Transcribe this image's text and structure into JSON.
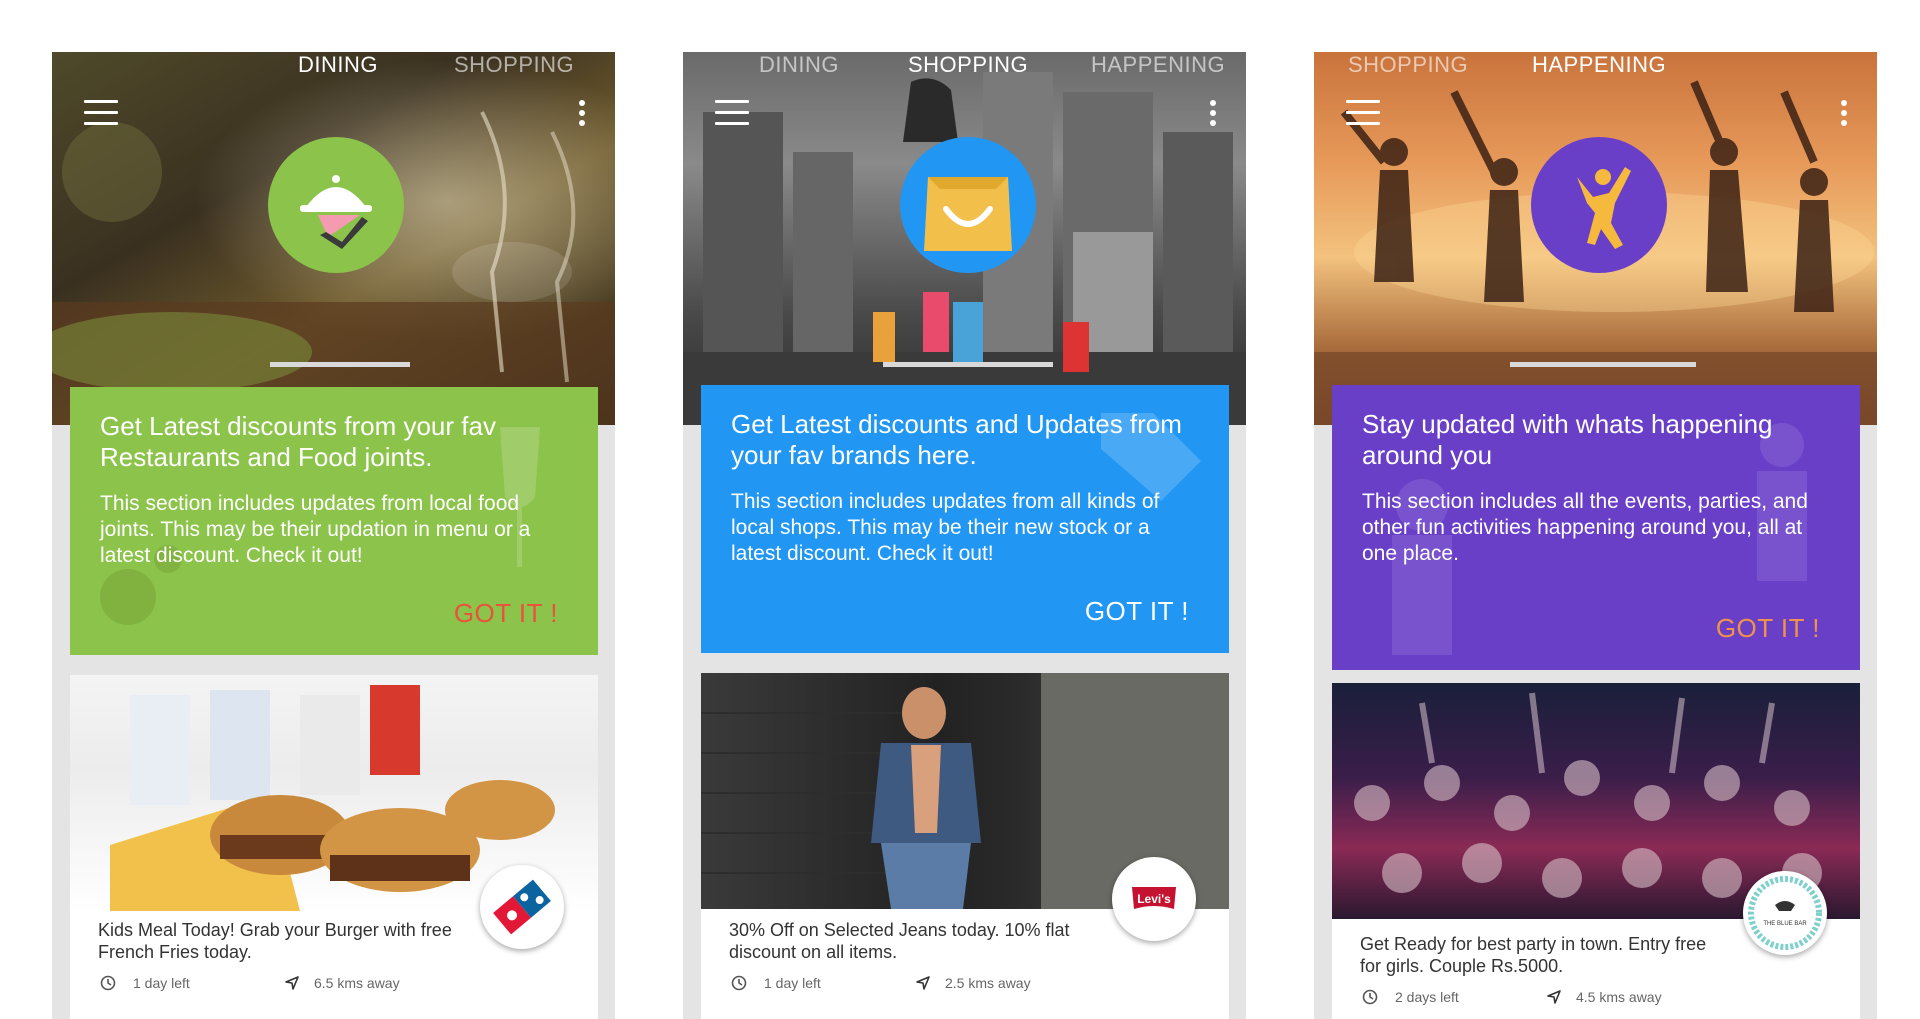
{
  "dining": {
    "tabs": [
      "DINING",
      "SHOPPING"
    ],
    "badge_icon": "cloche-icon",
    "title": "Get Latest discounts from your fav Restaurants and Food joints.",
    "description": "This section includes updates from local food joints. This may be their updation in menu or a latest discount. Check it out!",
    "cta": "GOT IT !",
    "deal": {
      "text": "Kids Meal Today! Grab your Burger with free French Fries today.",
      "time_left": "1 day left",
      "distance": "6.5 kms away",
      "brand_icon": "dominos-logo"
    }
  },
  "shopping": {
    "tabs": [
      "DINING",
      "SHOPPING",
      "HAPPENING"
    ],
    "badge_icon": "shopping-bag-icon",
    "title": "Get Latest discounts and Updates from your fav brands here.",
    "description": "This section includes updates from all kinds of local shops. This may be their new stock or a latest discount. Check it out!",
    "cta": "GOT IT !",
    "deal": {
      "text": "30% Off on Selected Jeans today. 10% flat discount on all items.",
      "time_left": "1 day left",
      "distance": "2.5 kms away",
      "brand_icon": "levis-logo",
      "brand_text": "Levi's"
    }
  },
  "happening": {
    "tabs": [
      "SHOPPING",
      "HAPPENING"
    ],
    "badge_icon": "dancing-person-icon",
    "title": "Stay updated with whats happening around you",
    "description": "This section includes all the events, parties, and other fun activities happening around you, all at one place.",
    "cta": "GOT IT !",
    "deal": {
      "text": "Get Ready for best party in town. Entry free for girls. Couple Rs.5000.",
      "time_left": "2 days left",
      "distance": "4.5 kms away",
      "brand_icon": "blue-bar-logo",
      "brand_text": "THE BLUE BAR"
    }
  },
  "colors": {
    "dining": "#8cc34a",
    "shopping": "#2196f3",
    "happening": "#6a3fc8",
    "cta_dining": "#e8533a",
    "cta_shopping": "#ffffff",
    "cta_happening": "#f0924a"
  }
}
